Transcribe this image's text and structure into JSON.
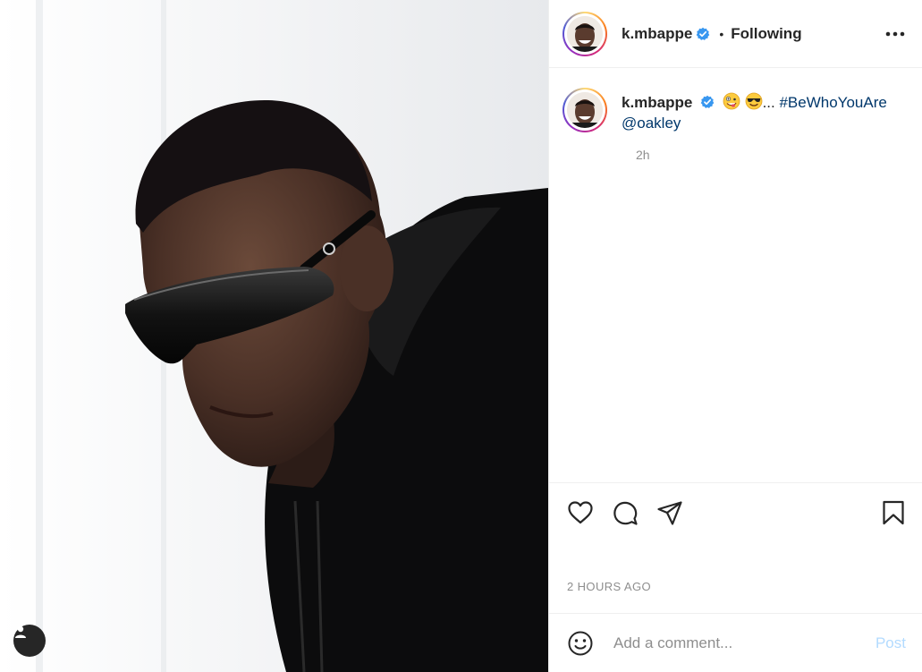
{
  "post": {
    "photo_alt": "",
    "header": {
      "username": "k.mbappe",
      "separator": "•",
      "follow_status": "Following"
    },
    "caption": {
      "username": "k.mbappe",
      "ellipsis": "...",
      "hashtag": "#BeWhoYouAre",
      "mention": "@oakley",
      "relative_time": "2h",
      "emojis": [
        "zany-face-emoji",
        "smiling-face-with-sunglasses-emoji"
      ]
    },
    "actions": {
      "timestamp": "2 HOURS AGO"
    },
    "comment": {
      "placeholder": "Add a comment...",
      "post_label": "Post"
    }
  },
  "colors": {
    "verified": "#3897f0",
    "link": "#00376b",
    "post_disabled": "#b3dbff",
    "muted": "#8e8e8e"
  },
  "icons": [
    "user-tag-icon",
    "verified-badge-icon",
    "more-options-icon",
    "heart-icon",
    "comment-icon",
    "share-icon",
    "bookmark-icon",
    "emoji-smile-icon"
  ]
}
